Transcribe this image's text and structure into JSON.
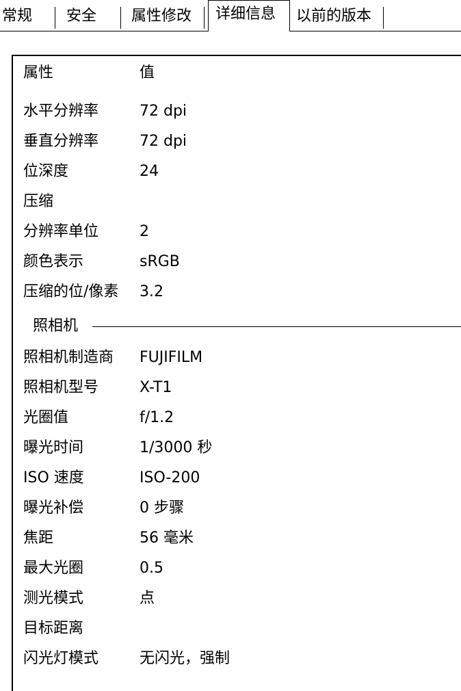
{
  "tabs": [
    {
      "label": "常规",
      "active": false
    },
    {
      "label": "安全",
      "active": false
    },
    {
      "label": "属性修改",
      "active": false
    },
    {
      "label": "详细信息",
      "active": true
    },
    {
      "label": "以前的版本",
      "active": false
    }
  ],
  "list": {
    "header": {
      "name": "属性",
      "value": "值"
    },
    "image_rows": [
      {
        "name": "水平分辨率",
        "value": "72 dpi"
      },
      {
        "name": "垂直分辨率",
        "value": "72 dpi"
      },
      {
        "name": "位深度",
        "value": "24"
      },
      {
        "name": "压缩",
        "value": ""
      },
      {
        "name": "分辨率单位",
        "value": "2"
      },
      {
        "name": "颜色表示",
        "value": "sRGB"
      },
      {
        "name": "压缩的位/像素",
        "value": "3.2"
      }
    ],
    "camera_group": {
      "label": "照相机"
    },
    "camera_rows": [
      {
        "name": "照相机制造商",
        "value": "FUJIFILM"
      },
      {
        "name": "照相机型号",
        "value": "X-T1"
      },
      {
        "name": "光圈值",
        "value": "f/1.2"
      },
      {
        "name": "曝光时间",
        "value": "1/3000 秒"
      },
      {
        "name": "ISO 速度",
        "value": "ISO-200"
      },
      {
        "name": "曝光补偿",
        "value": "0 步骤"
      },
      {
        "name": "焦距",
        "value": "56 毫米"
      },
      {
        "name": "最大光圈",
        "value": "0.5"
      },
      {
        "name": "测光模式",
        "value": "点"
      },
      {
        "name": "目标距离",
        "value": ""
      },
      {
        "name": "闪光灯模式",
        "value": "无闪光，强制"
      }
    ]
  }
}
